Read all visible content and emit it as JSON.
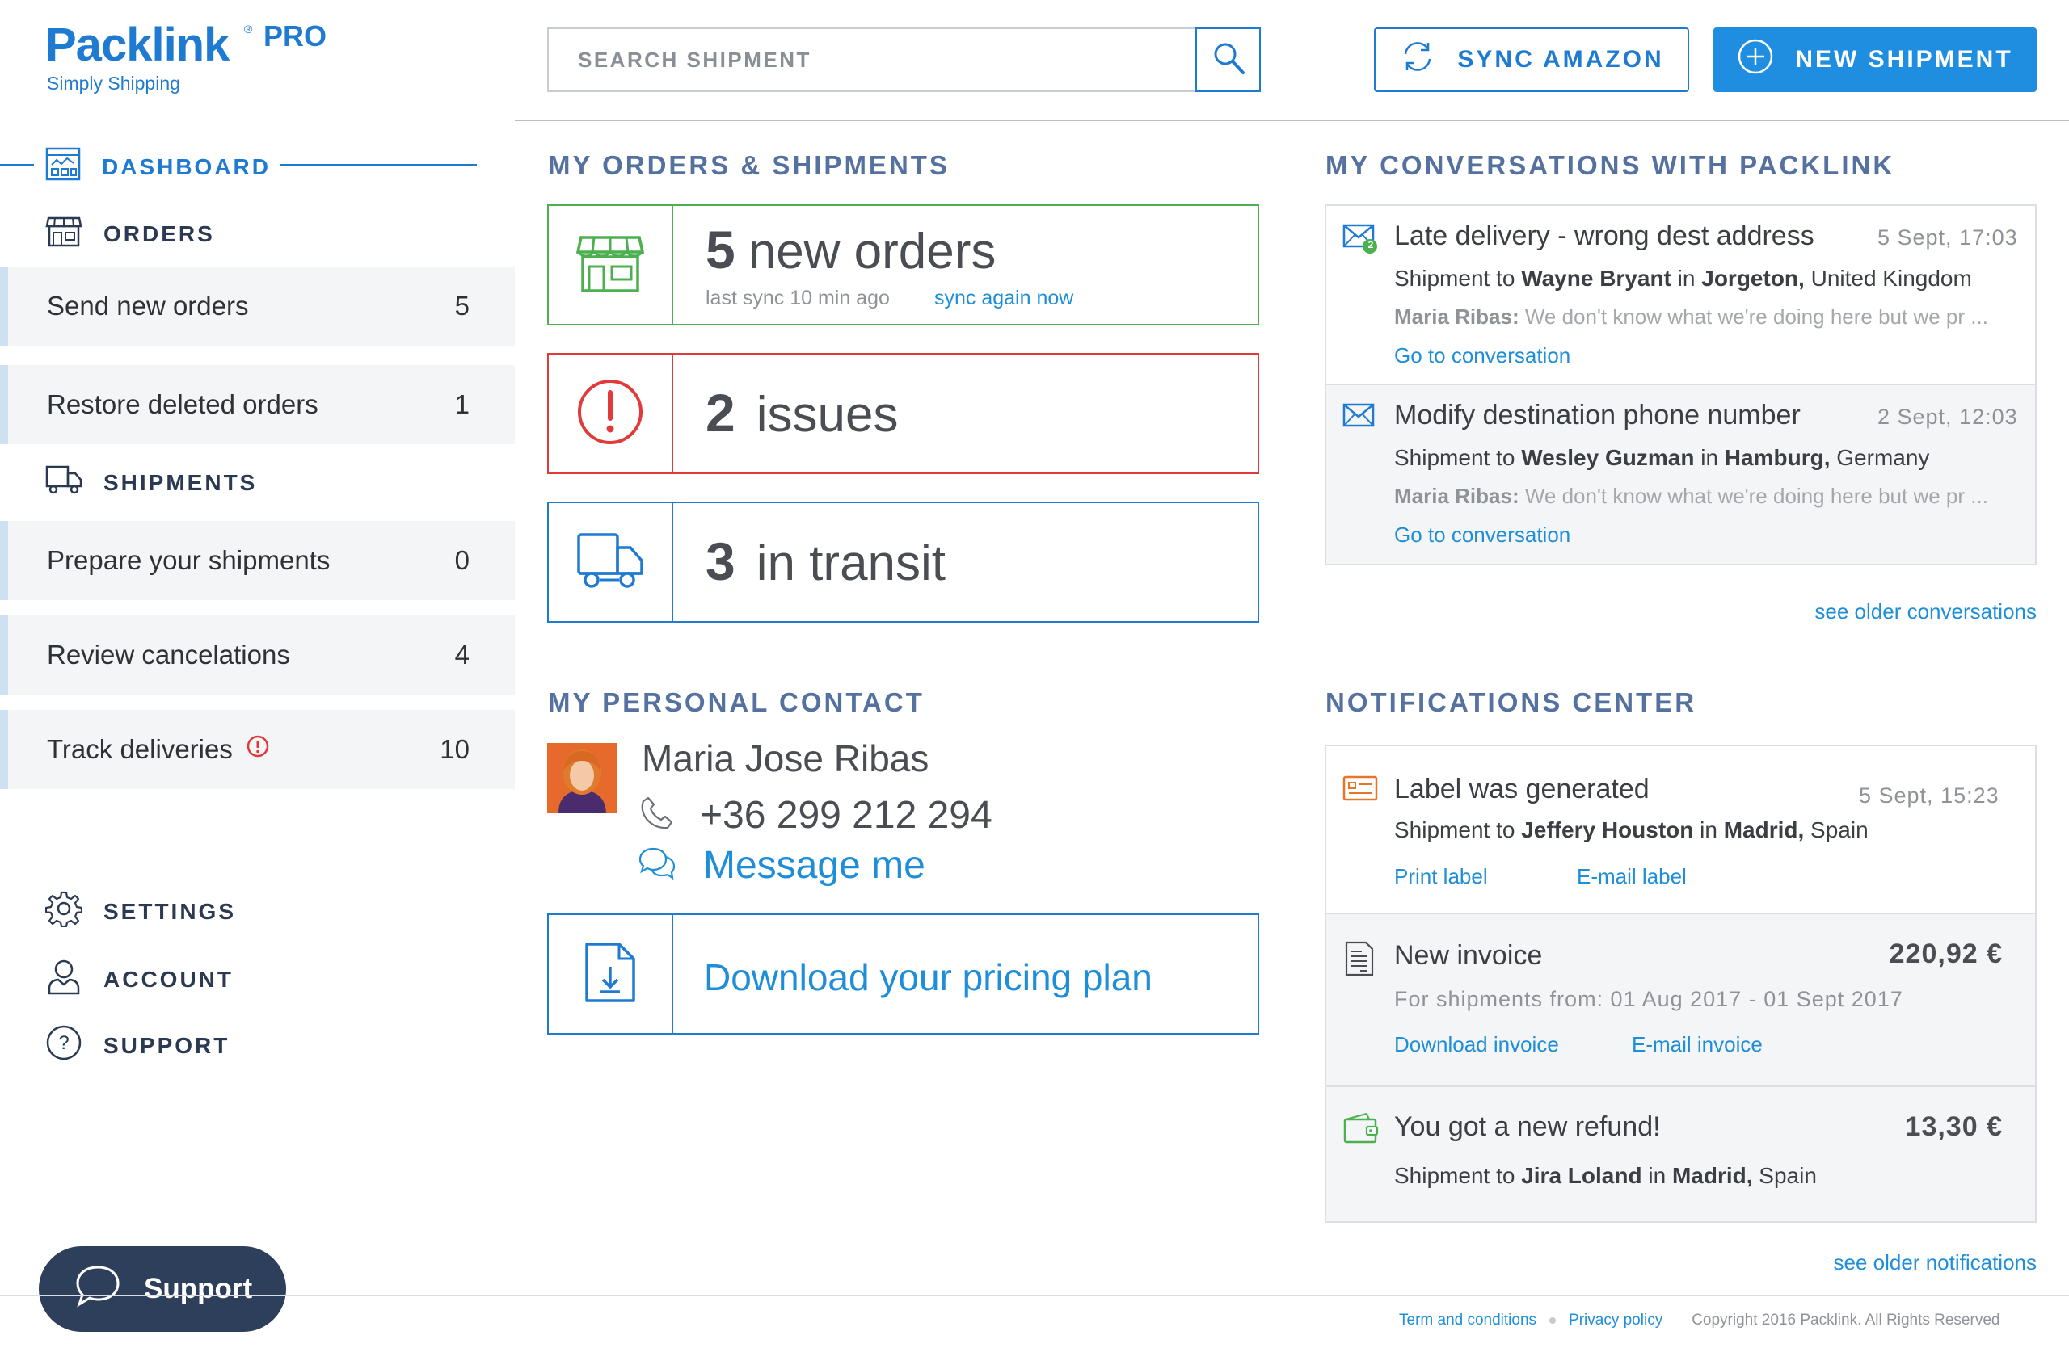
{
  "brand": {
    "name": "Packlink",
    "reg": "®",
    "tier": "PRO",
    "tagline": "Simply Shipping"
  },
  "header": {
    "search_placeholder": "SEARCH SHIPMENT",
    "sync_label": "SYNC AMAZON",
    "new_shipment_label": "NEW SHIPMENT"
  },
  "sidebar": {
    "dashboard": "DASHBOARD",
    "orders": "ORDERS",
    "orders_items": [
      {
        "label": "Send new orders",
        "count": "5"
      },
      {
        "label": "Restore deleted orders",
        "count": "1"
      }
    ],
    "shipments": "SHIPMENTS",
    "shipments_items": [
      {
        "label": "Prepare your shipments",
        "count": "0"
      },
      {
        "label": "Review cancelations",
        "count": "4"
      },
      {
        "label": "Track deliveries",
        "count": "10"
      }
    ],
    "settings": "SETTINGS",
    "account": "ACCOUNT",
    "support": "SUPPORT",
    "support_button": "Support"
  },
  "orders_section": {
    "title": "MY ORDERS & SHIPMENTS",
    "new_orders": {
      "count": "5",
      "label": "new orders",
      "last_sync": "last sync 10 min ago",
      "sync_link": "sync again now"
    },
    "issues": {
      "count": "2",
      "label": "issues"
    },
    "transit": {
      "count": "3",
      "label": "in transit"
    }
  },
  "contact_section": {
    "title": "MY PERSONAL CONTACT",
    "name": "Maria Jose Ribas",
    "phone": "+36 299 212 294",
    "message": "Message me",
    "download": "Download your pricing plan"
  },
  "conversations": {
    "title": "MY CONVERSATIONS WITH PACKLINK",
    "items": [
      {
        "subject": "Late delivery - wrong dest address",
        "date": "5 Sept, 17:03",
        "badge": "2",
        "pre": "Shipment to ",
        "person": "Wayne Bryant",
        "mid": " in ",
        "city": "Jorgeton,",
        "country": " United Kingdom",
        "author": "Maria Ribas:",
        "snippet": " We don't know what we're doing here but we pr ...",
        "link": "Go to conversation"
      },
      {
        "subject": "Modify destination phone number",
        "date": "2 Sept, 12:03",
        "pre": "Shipment to ",
        "person": "Wesley Guzman",
        "mid": " in ",
        "city": "Hamburg,",
        "country": " Germany",
        "author": "Maria Ribas:",
        "snippet": " We don't know what we're doing here but we pr ...",
        "link": "Go to conversation"
      }
    ],
    "older_link": "see older conversations"
  },
  "notifications": {
    "title": "NOTIFICATIONS CENTER",
    "label": {
      "title": "Label was generated",
      "date": "5 Sept, 15:23",
      "pre": "Shipment to ",
      "person": "Jeffery Houston",
      "mid": " in ",
      "city": "Madrid,",
      "country": " Spain",
      "link1": "Print label",
      "link2": "E-mail label"
    },
    "invoice": {
      "title": "New invoice",
      "amount": "220,92 €",
      "period": "For shipments from: 01 Aug 2017 - 01 Sept 2017",
      "link1": "Download invoice",
      "link2": "E-mail invoice"
    },
    "refund": {
      "title": "You got a new refund!",
      "amount": "13,30 €",
      "pre": "Shipment to ",
      "person": "Jira Loland",
      "mid": " in ",
      "city": "Madrid,",
      "country": " Spain"
    },
    "older_link": "see older notifications"
  },
  "footer": {
    "terms": "Term and conditions",
    "privacy": "Privacy policy",
    "copyright": "Copyright 2016 Packlink. All Rights Reserved"
  },
  "colors": {
    "brand_blue": "#1f7ad1",
    "orders_green": "#4cb04f",
    "issues_red": "#e03a3a",
    "section_title": "#5571a0",
    "nav_dark": "#2b3a52"
  }
}
